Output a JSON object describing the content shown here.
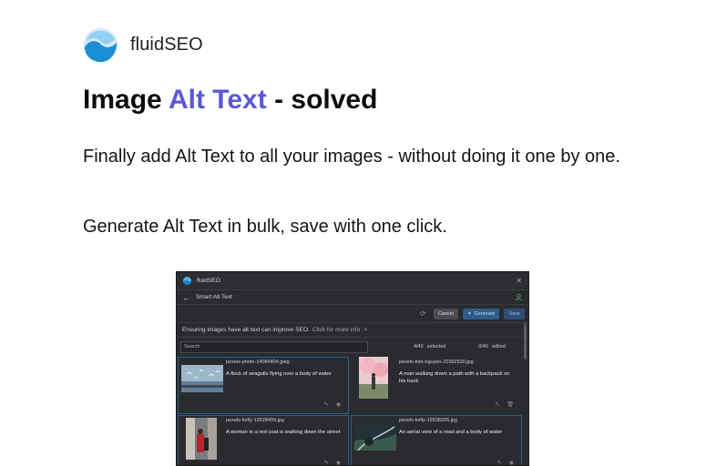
{
  "brand": {
    "name": "fluidSEO",
    "logo_icon": "wave-logo-icon"
  },
  "headline": {
    "prefix": "Image ",
    "accent": "Alt Text",
    "suffix": " - solved",
    "accent_color": "#5b57d6"
  },
  "paragraphs": {
    "p1": "Finally add Alt Text to all your images - without doing it one by one.",
    "p2": "Generate Alt Text in bulk, save with one click."
  },
  "app": {
    "window_title": "fluidSEO",
    "nav_title": "Smart Alt Text",
    "toolbar": {
      "cancel": "Cancel",
      "generate": "Generate",
      "save": "Save"
    },
    "info": {
      "text": "Ensuring images have alt text can improve SEO.",
      "link": "Click for more info",
      "chevron": ">"
    },
    "search_placeholder": "Search",
    "selected_count": "4/40",
    "selected_label": "selected",
    "edited_count": "0/40",
    "edited_label": "edited",
    "images": [
      {
        "filename": "pexels-photo-14084804.jpeg",
        "alt": "A flock of seagulls flying over a body of water",
        "selected": true
      },
      {
        "filename": "pexels-tien-nguyen-20392530.jpg",
        "alt": "A man walking down a path with a backpack on his back",
        "selected": false
      },
      {
        "filename": "pexels-kelly-19528499.jpg",
        "alt": "A woman in a red coat is walking down the street",
        "selected": true
      },
      {
        "filename": "pexels-kelly-19938265.jpg",
        "alt": "An aerial view of a road and a body of water",
        "selected": true
      }
    ]
  }
}
